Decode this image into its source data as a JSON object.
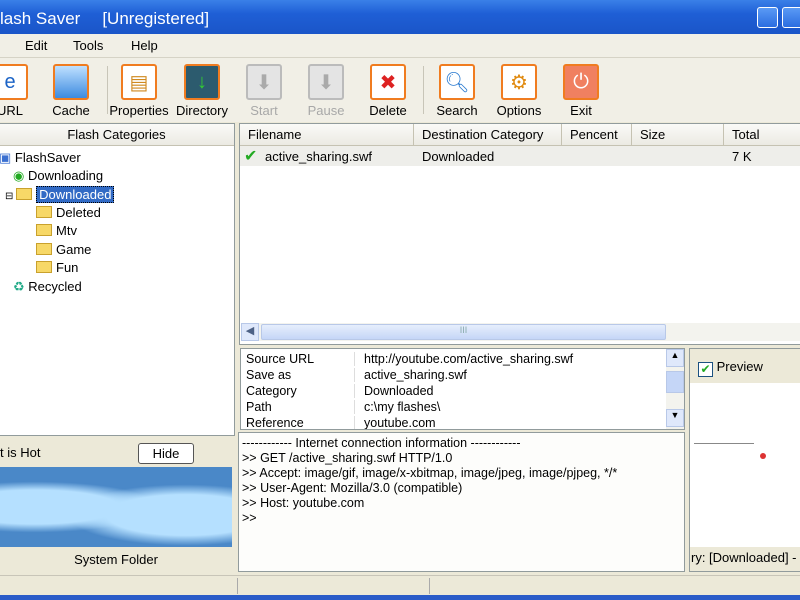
{
  "window": {
    "title": "lash Saver",
    "status": "[Unregistered]"
  },
  "menu": [
    "Edit",
    "Tools",
    "Help"
  ],
  "toolbar": [
    {
      "label": "URL",
      "icon": "ie-icon"
    },
    {
      "label": "Cache",
      "icon": "cache-icon"
    },
    {
      "label": "Properties",
      "icon": "properties-icon"
    },
    {
      "label": "Directory",
      "icon": "directory-icon"
    },
    {
      "label": "Start",
      "icon": "start-icon",
      "disabled": true
    },
    {
      "label": "Pause",
      "icon": "pause-icon",
      "disabled": true
    },
    {
      "label": "Delete",
      "icon": "delete-icon"
    },
    {
      "label": "Search",
      "icon": "search-icon"
    },
    {
      "label": "Options",
      "icon": "options-icon"
    },
    {
      "label": "Exit",
      "icon": "exit-icon"
    }
  ],
  "left": {
    "header": "Flash Categories",
    "tree": {
      "root": "FlashSaver",
      "downloading": "Downloading",
      "downloaded": "Downloaded",
      "children": [
        "Deleted",
        "Mtv",
        "Game",
        "Fun"
      ],
      "recycled": "Recycled"
    },
    "hot_label": "t is Hot",
    "hide": "Hide",
    "system_folder": "System Folder"
  },
  "list": {
    "columns": [
      "Filename",
      "Destination Category",
      "Pencent",
      "Size",
      "Total"
    ],
    "rows": [
      {
        "filename": "active_sharing.swf",
        "category": "Downloaded",
        "percent": "",
        "size": "",
        "total": "7 K"
      }
    ],
    "scroll_grip": "III"
  },
  "props": [
    {
      "k": "Source URL",
      "v": "http://youtube.com/active_sharing.swf"
    },
    {
      "k": "Save as",
      "v": "active_sharing.swf"
    },
    {
      "k": "Category",
      "v": "Downloaded"
    },
    {
      "k": "Path",
      "v": "c:\\my flashes\\"
    },
    {
      "k": "Reference",
      "v": "youtube.com"
    }
  ],
  "log": [
    "------------  Internet connection information  ------------",
    ">> GET /active_sharing.swf HTTP/1.0",
    ">> Accept: image/gif, image/x-xbitmap, image/jpeg, image/pjpeg, */*",
    ">> User-Agent: Mozilla/3.0 (compatible)",
    ">> Host: youtube.com",
    ">>"
  ],
  "preview": {
    "label": "Preview",
    "checked": true,
    "footer": "ry: [Downloaded] - c"
  }
}
